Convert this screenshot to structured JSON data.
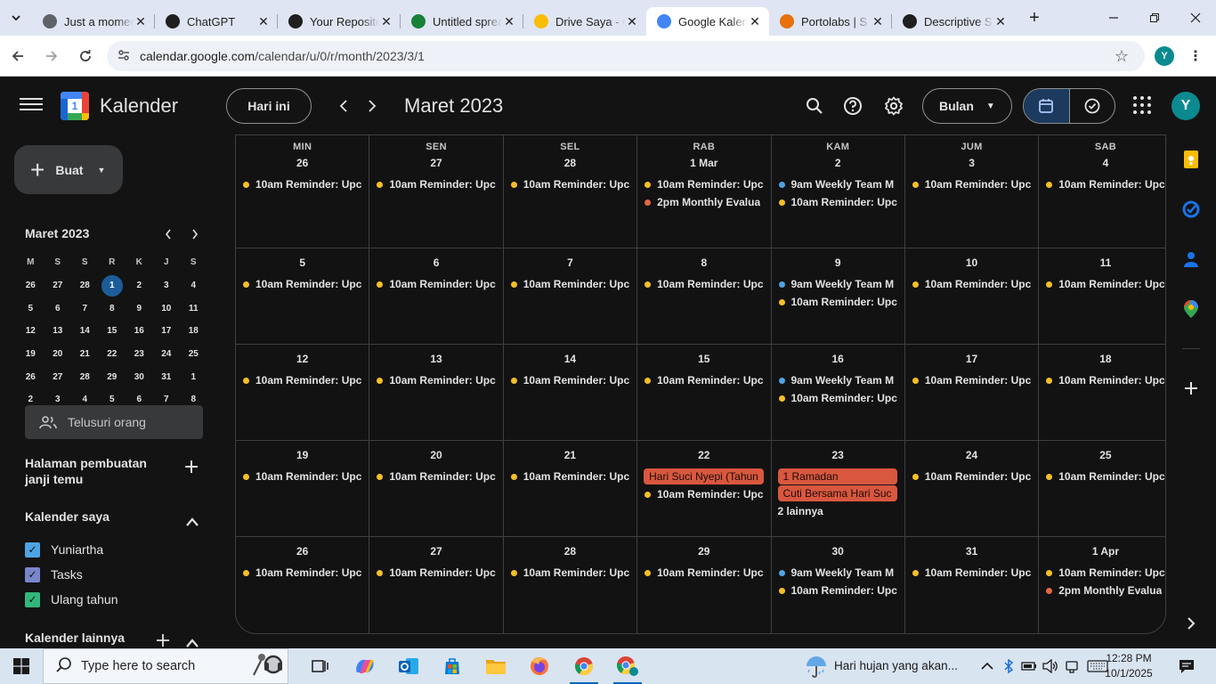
{
  "browser": {
    "tabs": [
      {
        "title": "Just a moment...",
        "favicon": "globe-icon",
        "color": "#5f6368",
        "active": false
      },
      {
        "title": "ChatGPT",
        "favicon": "chatgpt-icon",
        "color": "#1f1f1f",
        "active": false
      },
      {
        "title": "Your Repositories",
        "favicon": "github-icon",
        "color": "#1f1f1f",
        "active": false
      },
      {
        "title": "Untitled spreadsheet",
        "favicon": "sheets-icon",
        "color": "#188038",
        "active": false
      },
      {
        "title": "Drive Saya - Google Drive",
        "favicon": "drive-icon",
        "color": "#fbbc04",
        "active": false
      },
      {
        "title": "Google Kalender",
        "favicon": "calendar-icon",
        "color": "#4285f4",
        "active": true
      },
      {
        "title": "Portolabs | S",
        "favicon": "portolabs-icon",
        "color": "#e8710a",
        "active": false
      },
      {
        "title": "Descriptive S",
        "favicon": "go-icon",
        "color": "#1f1f1f",
        "active": false
      }
    ],
    "url_host": "calendar.google.com",
    "url_path": "/calendar/u/0/r/month/2023/3/1",
    "profile_initial": "Y"
  },
  "calendar": {
    "brand": "Kalender",
    "logo_number": "1",
    "today_label": "Hari ini",
    "month_title": "Maret 2023",
    "view_label": "Bulan",
    "avatar_initial": "Y",
    "weekday_labels": [
      "MIN",
      "SEN",
      "SEL",
      "RAB",
      "KAM",
      "JUM",
      "SAB"
    ],
    "weeks": [
      [
        {
          "date": "26",
          "events": [
            {
              "text": "10am Reminder: Upc",
              "color": "#f6bf26"
            }
          ]
        },
        {
          "date": "27",
          "events": [
            {
              "text": "10am Reminder: Upc",
              "color": "#f6bf26"
            }
          ]
        },
        {
          "date": "28",
          "events": [
            {
              "text": "10am Reminder: Upc",
              "color": "#f6bf26"
            }
          ]
        },
        {
          "date": "1 Mar",
          "events": [
            {
              "text": "10am Reminder: Upc",
              "color": "#f6bf26"
            },
            {
              "text": "2pm Monthly Evalua",
              "color": "#e4683f"
            }
          ]
        },
        {
          "date": "2",
          "events": [
            {
              "text": "9am Weekly Team M",
              "color": "#4fa3e3"
            },
            {
              "text": "10am Reminder: Upc",
              "color": "#f6bf26"
            }
          ]
        },
        {
          "date": "3",
          "events": [
            {
              "text": "10am Reminder: Upc",
              "color": "#f6bf26"
            }
          ]
        },
        {
          "date": "4",
          "events": [
            {
              "text": "10am Reminder: Upc",
              "color": "#f6bf26"
            }
          ]
        }
      ],
      [
        {
          "date": "5",
          "events": [
            {
              "text": "10am Reminder: Upc",
              "color": "#f6bf26"
            }
          ]
        },
        {
          "date": "6",
          "events": [
            {
              "text": "10am Reminder: Upc",
              "color": "#f6bf26"
            }
          ]
        },
        {
          "date": "7",
          "events": [
            {
              "text": "10am Reminder: Upc",
              "color": "#f6bf26"
            }
          ]
        },
        {
          "date": "8",
          "events": [
            {
              "text": "10am Reminder: Upc",
              "color": "#f6bf26"
            }
          ]
        },
        {
          "date": "9",
          "events": [
            {
              "text": "9am Weekly Team M",
              "color": "#4fa3e3"
            },
            {
              "text": "10am Reminder: Upc",
              "color": "#f6bf26"
            }
          ]
        },
        {
          "date": "10",
          "events": [
            {
              "text": "10am Reminder: Upc",
              "color": "#f6bf26"
            }
          ]
        },
        {
          "date": "11",
          "events": [
            {
              "text": "10am Reminder: Upc",
              "color": "#f6bf26"
            }
          ]
        }
      ],
      [
        {
          "date": "12",
          "events": [
            {
              "text": "10am Reminder: Upc",
              "color": "#f6bf26"
            }
          ]
        },
        {
          "date": "13",
          "events": [
            {
              "text": "10am Reminder: Upc",
              "color": "#f6bf26"
            }
          ]
        },
        {
          "date": "14",
          "events": [
            {
              "text": "10am Reminder: Upc",
              "color": "#f6bf26"
            }
          ]
        },
        {
          "date": "15",
          "events": [
            {
              "text": "10am Reminder: Upc",
              "color": "#f6bf26"
            }
          ]
        },
        {
          "date": "16",
          "events": [
            {
              "text": "9am Weekly Team M",
              "color": "#4fa3e3"
            },
            {
              "text": "10am Reminder: Upc",
              "color": "#f6bf26"
            }
          ]
        },
        {
          "date": "17",
          "events": [
            {
              "text": "10am Reminder: Upc",
              "color": "#f6bf26"
            }
          ]
        },
        {
          "date": "18",
          "events": [
            {
              "text": "10am Reminder: Upc",
              "color": "#f6bf26"
            }
          ]
        }
      ],
      [
        {
          "date": "19",
          "events": [
            {
              "text": "10am Reminder: Upc",
              "color": "#f6bf26"
            }
          ]
        },
        {
          "date": "20",
          "events": [
            {
              "text": "10am Reminder: Upc",
              "color": "#f6bf26"
            }
          ]
        },
        {
          "date": "21",
          "events": [
            {
              "text": "10am Reminder: Upc",
              "color": "#f6bf26"
            }
          ]
        },
        {
          "date": "22",
          "events": [
            {
              "text": "Hari Suci Nyepi (Tahun",
              "chip": true
            },
            {
              "text": "10am Reminder: Upc",
              "color": "#f6bf26"
            }
          ]
        },
        {
          "date": "23",
          "events": [
            {
              "text": "1 Ramadan",
              "chip": true
            },
            {
              "text": "Cuti Bersama Hari Suc",
              "chip": true
            },
            {
              "text": "2 lainnya",
              "more": true
            }
          ]
        },
        {
          "date": "24",
          "events": [
            {
              "text": "10am Reminder: Upc",
              "color": "#f6bf26"
            }
          ]
        },
        {
          "date": "25",
          "events": [
            {
              "text": "10am Reminder: Upc",
              "color": "#f6bf26"
            }
          ]
        }
      ],
      [
        {
          "date": "26",
          "events": [
            {
              "text": "10am Reminder: Upc",
              "color": "#f6bf26"
            }
          ]
        },
        {
          "date": "27",
          "events": [
            {
              "text": "10am Reminder: Upc",
              "color": "#f6bf26"
            }
          ]
        },
        {
          "date": "28",
          "events": [
            {
              "text": "10am Reminder: Upc",
              "color": "#f6bf26"
            }
          ]
        },
        {
          "date": "29",
          "events": [
            {
              "text": "10am Reminder: Upc",
              "color": "#f6bf26"
            }
          ]
        },
        {
          "date": "30",
          "events": [
            {
              "text": "9am Weekly Team M",
              "color": "#4fa3e3"
            },
            {
              "text": "10am Reminder: Upc",
              "color": "#f6bf26"
            }
          ]
        },
        {
          "date": "31",
          "events": [
            {
              "text": "10am Reminder: Upc",
              "color": "#f6bf26"
            }
          ]
        },
        {
          "date": "1 Apr",
          "events": [
            {
              "text": "10am Reminder: Upc",
              "color": "#f6bf26"
            },
            {
              "text": "2pm Monthly Evalua",
              "color": "#e4683f"
            }
          ]
        }
      ]
    ]
  },
  "sidebar": {
    "create_label": "Buat",
    "mini_title": "Maret 2023",
    "mini_dow": [
      "M",
      "S",
      "S",
      "R",
      "K",
      "J",
      "S"
    ],
    "mini_days": [
      "26",
      "27",
      "28",
      "1",
      "2",
      "3",
      "4",
      "5",
      "6",
      "7",
      "8",
      "9",
      "10",
      "11",
      "12",
      "13",
      "14",
      "15",
      "16",
      "17",
      "18",
      "19",
      "20",
      "21",
      "22",
      "23",
      "24",
      "25",
      "26",
      "27",
      "28",
      "29",
      "30",
      "31",
      "1",
      "2",
      "3",
      "4",
      "5",
      "6",
      "7",
      "8"
    ],
    "mini_selected": "1",
    "search_people": "Telusuri orang",
    "booking_title": "Halaman pembuatan janji temu",
    "my_calendars_title": "Kalender saya",
    "my_calendars": [
      {
        "label": "Yuniartha",
        "color": "#4fa3e3"
      },
      {
        "label": "Tasks",
        "color": "#7986cb"
      },
      {
        "label": "Ulang tahun",
        "color": "#33b679"
      }
    ],
    "other_calendars_title": "Kalender lainnya"
  },
  "taskbar": {
    "search_placeholder": "Type here to search",
    "weather_text": "Hari hujan yang akan...",
    "time": "12:28 PM",
    "date": "10/1/2025"
  }
}
